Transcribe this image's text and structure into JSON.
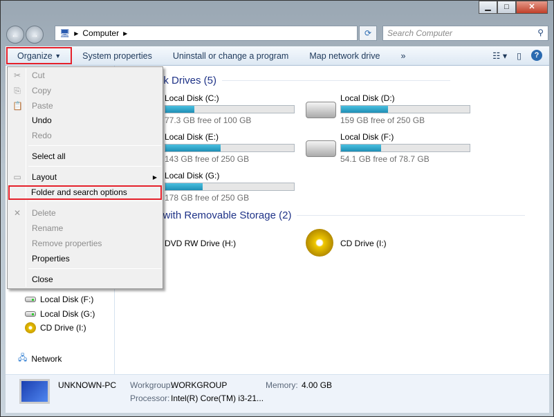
{
  "window": {
    "minimize": "▁",
    "maximize": "□",
    "close": "✕"
  },
  "address": {
    "path": [
      "Computer"
    ],
    "search_placeholder": "Search Computer"
  },
  "toolbar": {
    "organize": "Organize",
    "system_properties": "System properties",
    "uninstall": "Uninstall or change a program",
    "map_drive": "Map network drive",
    "more": "»"
  },
  "groups": {
    "hdd": "Hard Disk Drives (5)",
    "removable": "Devices with Removable Storage (2)"
  },
  "drives": [
    {
      "name": "Local Disk (C:)",
      "free": "77.3 GB free of 100 GB",
      "used_percent": 22.7
    },
    {
      "name": "Local Disk (D:)",
      "free": "159 GB free of 250 GB",
      "used_percent": 36.4
    },
    {
      "name": "Local Disk (E:)",
      "free": "143 GB free of 250 GB",
      "used_percent": 42.8
    },
    {
      "name": "Local Disk (F:)",
      "free": "54.1 GB free of 78.7 GB",
      "used_percent": 31.3
    },
    {
      "name": "Local Disk (G:)",
      "free": "178 GB free of 250 GB",
      "used_percent": 28.8
    }
  ],
  "removable": [
    {
      "name": "DVD RW Drive (H:)"
    },
    {
      "name": "CD Drive (I:)"
    }
  ],
  "nav": {
    "items": [
      "Local Disk (F:)",
      "Local Disk (G:)",
      "CD Drive (I:)"
    ],
    "network": "Network"
  },
  "menu": {
    "items": [
      {
        "label": "Cut",
        "enabled": false
      },
      {
        "label": "Copy",
        "enabled": false
      },
      {
        "label": "Paste",
        "enabled": false
      },
      {
        "label": "Undo",
        "enabled": true
      },
      {
        "label": "Redo",
        "enabled": false
      },
      {
        "label": "Select all",
        "enabled": true
      },
      {
        "label": "Layout",
        "enabled": true
      },
      {
        "label": "Folder and search options",
        "enabled": true
      },
      {
        "label": "Delete",
        "enabled": false
      },
      {
        "label": "Rename",
        "enabled": false
      },
      {
        "label": "Remove properties",
        "enabled": false
      },
      {
        "label": "Properties",
        "enabled": true
      },
      {
        "label": "Close",
        "enabled": true
      }
    ]
  },
  "details": {
    "pc_name": "UNKNOWN-PC",
    "workgroup_label": "Workgroup:",
    "workgroup": "WORKGROUP",
    "memory_label": "Memory:",
    "memory": "4.00 GB",
    "processor_label": "Processor:",
    "processor": "Intel(R) Core(TM) i3-21..."
  },
  "colors": {
    "highlight": "#e5202a",
    "bar_fill": "#1f8fb5",
    "group_header": "#1e3287"
  }
}
